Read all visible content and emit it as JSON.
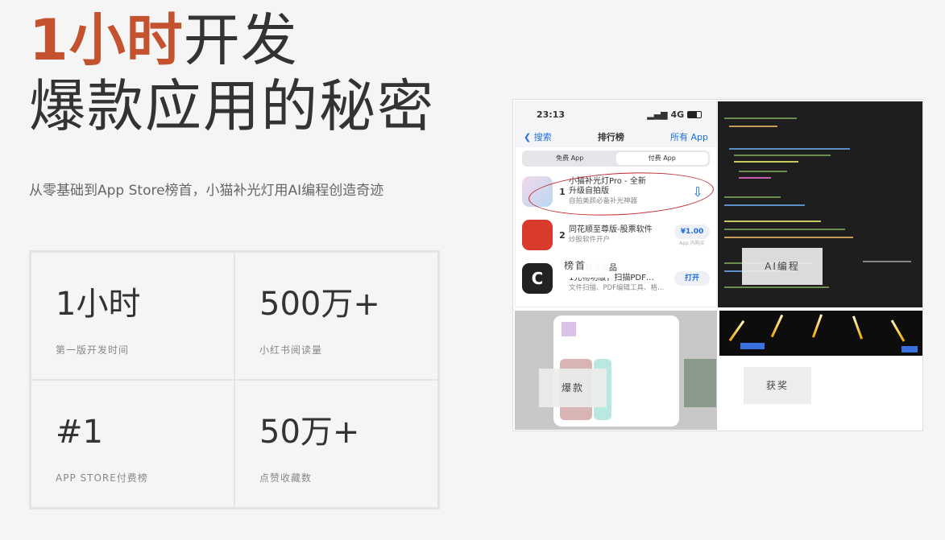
{
  "title": {
    "highlight": "1小时",
    "rest": "开发",
    "line2": "爆款应用的秘密"
  },
  "subtitle": "从零基础到App Store榜首，小猫补光灯用AI编程创造奇迹",
  "stats": [
    {
      "value": "1小时",
      "label": "第一版开发时间"
    },
    {
      "value": "500万+",
      "label": "小红书阅读量"
    },
    {
      "value": "#1",
      "label": "APP STORE付费榜"
    },
    {
      "value": "50万+",
      "label": "点赞收藏数"
    }
  ],
  "phone": {
    "time": "23:13",
    "signal": "4G",
    "back_label": "搜索",
    "nav_title": "排行榜",
    "nav_right": "所有 App",
    "segments": [
      "免费 App",
      "付费 App"
    ],
    "apps": [
      {
        "rank": "1",
        "name": "小猫补光灯Pro - 全新",
        "name2": "升级自拍版",
        "sub": "自拍美颜必备补光神器",
        "button": ""
      },
      {
        "rank": "2",
        "name": "同花顺至尊版-股票软件",
        "name2": "",
        "sub": "炒股软件开户",
        "button": "¥1.00",
        "note": "App 内购买"
      },
      {
        "rank": "",
        "name": "王 - 官方出品",
        "name2": "1元物功版，扫描PDF…",
        "sub": "文件扫描、PDF编辑工具、格…",
        "button": "打开"
      }
    ],
    "overlay": "榜首"
  },
  "overlays": {
    "code": "AI编程",
    "viral": "爆款",
    "award": "获奖"
  },
  "icons": {
    "back": "chevron-left-icon",
    "download": "cloud-download-icon",
    "wifi": "signal-icon"
  },
  "colors": {
    "accent": "#c4522f",
    "link": "#1a6fe0"
  }
}
